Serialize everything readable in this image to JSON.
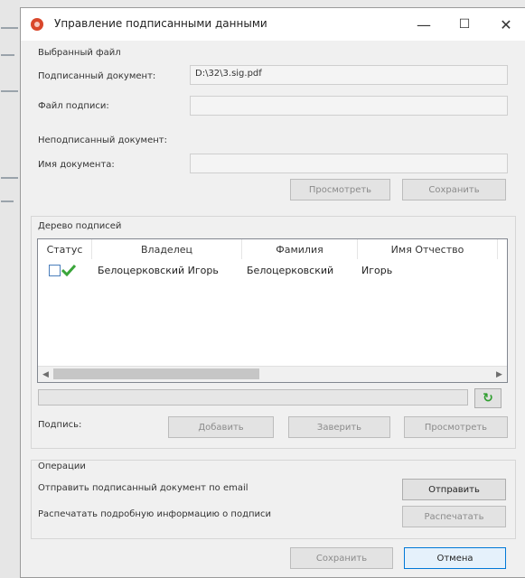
{
  "window": {
    "title": "Управление подписанными данными",
    "minimize_glyph": "—",
    "maximize_glyph": "☐",
    "close_glyph": "✕"
  },
  "selected_file": {
    "group_title": "Выбранный файл",
    "signed_doc_label": "Подписанный документ:",
    "signed_doc_value": "D:\\32\\3.sig.pdf",
    "signature_file_label": "Файл подписи:",
    "signature_file_value": ""
  },
  "unsigned": {
    "title": "Неподписанный документ:",
    "doc_name_label": "Имя документа:",
    "doc_name_value": "",
    "view_button": "Просмотреть",
    "save_button": "Сохранить"
  },
  "tree": {
    "group_title": "Дерево подписей",
    "columns": [
      "Статус",
      "Владелец",
      "Фамилия",
      "Имя Отчество"
    ],
    "rows": [
      {
        "owner": "Белоцерковский Игорь",
        "surname": "Белоцерковский",
        "name": "Игорь",
        "status": "valid"
      }
    ],
    "scroll_left": "◀",
    "scroll_right": "▶",
    "refresh_icon": "↻"
  },
  "signature": {
    "label": "Подпись:",
    "add_button": "Добавить",
    "certify_button": "Заверить",
    "view_button": "Просмотреть"
  },
  "operations": {
    "group_title": "Операции",
    "send_label": "Отправить подписанный документ по email",
    "send_button": "Отправить",
    "print_label": "Распечатать подробную информацию о подписи",
    "print_button": "Распечатать"
  },
  "footer": {
    "save_button": "Сохранить",
    "cancel_button": "Отмена"
  },
  "colors": {
    "accent": "#0078d7",
    "check_green": "#3aa53a",
    "app_icon": "#d9472b"
  }
}
